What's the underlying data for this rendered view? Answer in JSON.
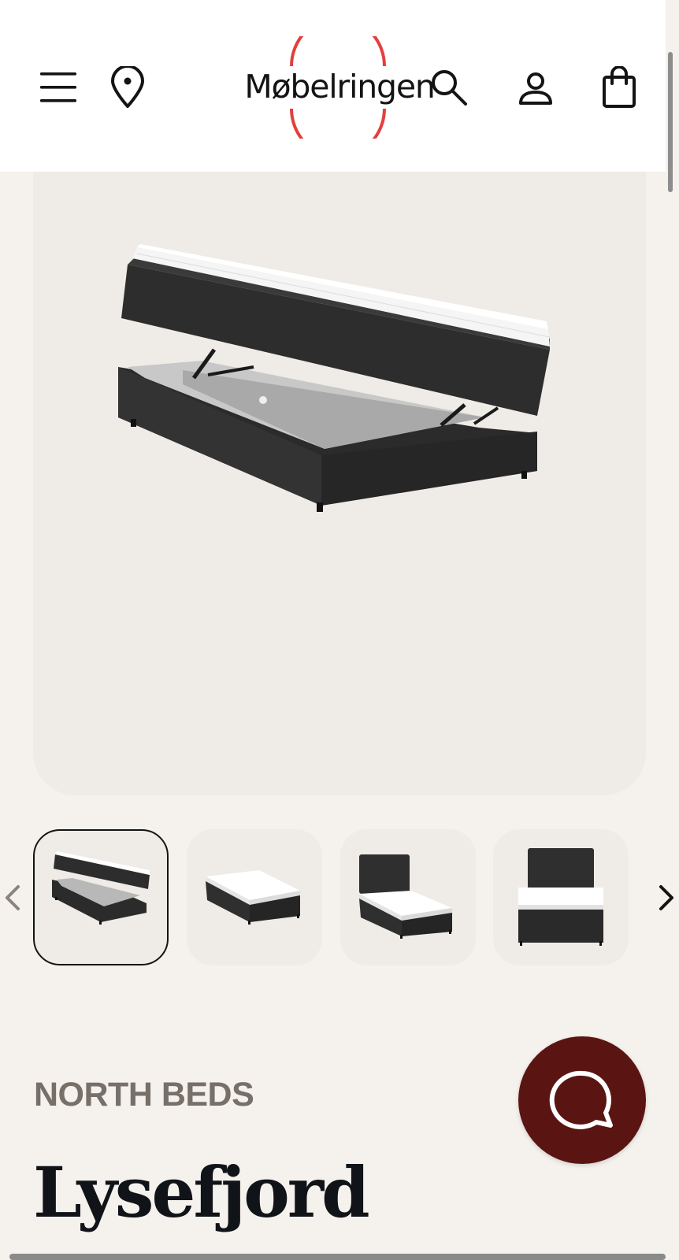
{
  "header": {
    "logo_text": "Møbelringen",
    "brand_color": "#e2403c",
    "icons": [
      "menu-icon",
      "location-pin-icon",
      "search-icon",
      "user-icon",
      "shopping-bag-icon"
    ]
  },
  "gallery": {
    "favorite_icon": "heart-icon",
    "expand_icon": "expand-arrows-icon",
    "thumbnail_count": 4,
    "active_thumbnail": 1,
    "prev_icon": "chevron-left-icon",
    "next_icon": "chevron-right-icon"
  },
  "product": {
    "brand": "NORTH BEDS",
    "name": "Lysefjord"
  },
  "chat": {
    "icon": "chat-bubble-icon",
    "color": "#5a1512"
  }
}
